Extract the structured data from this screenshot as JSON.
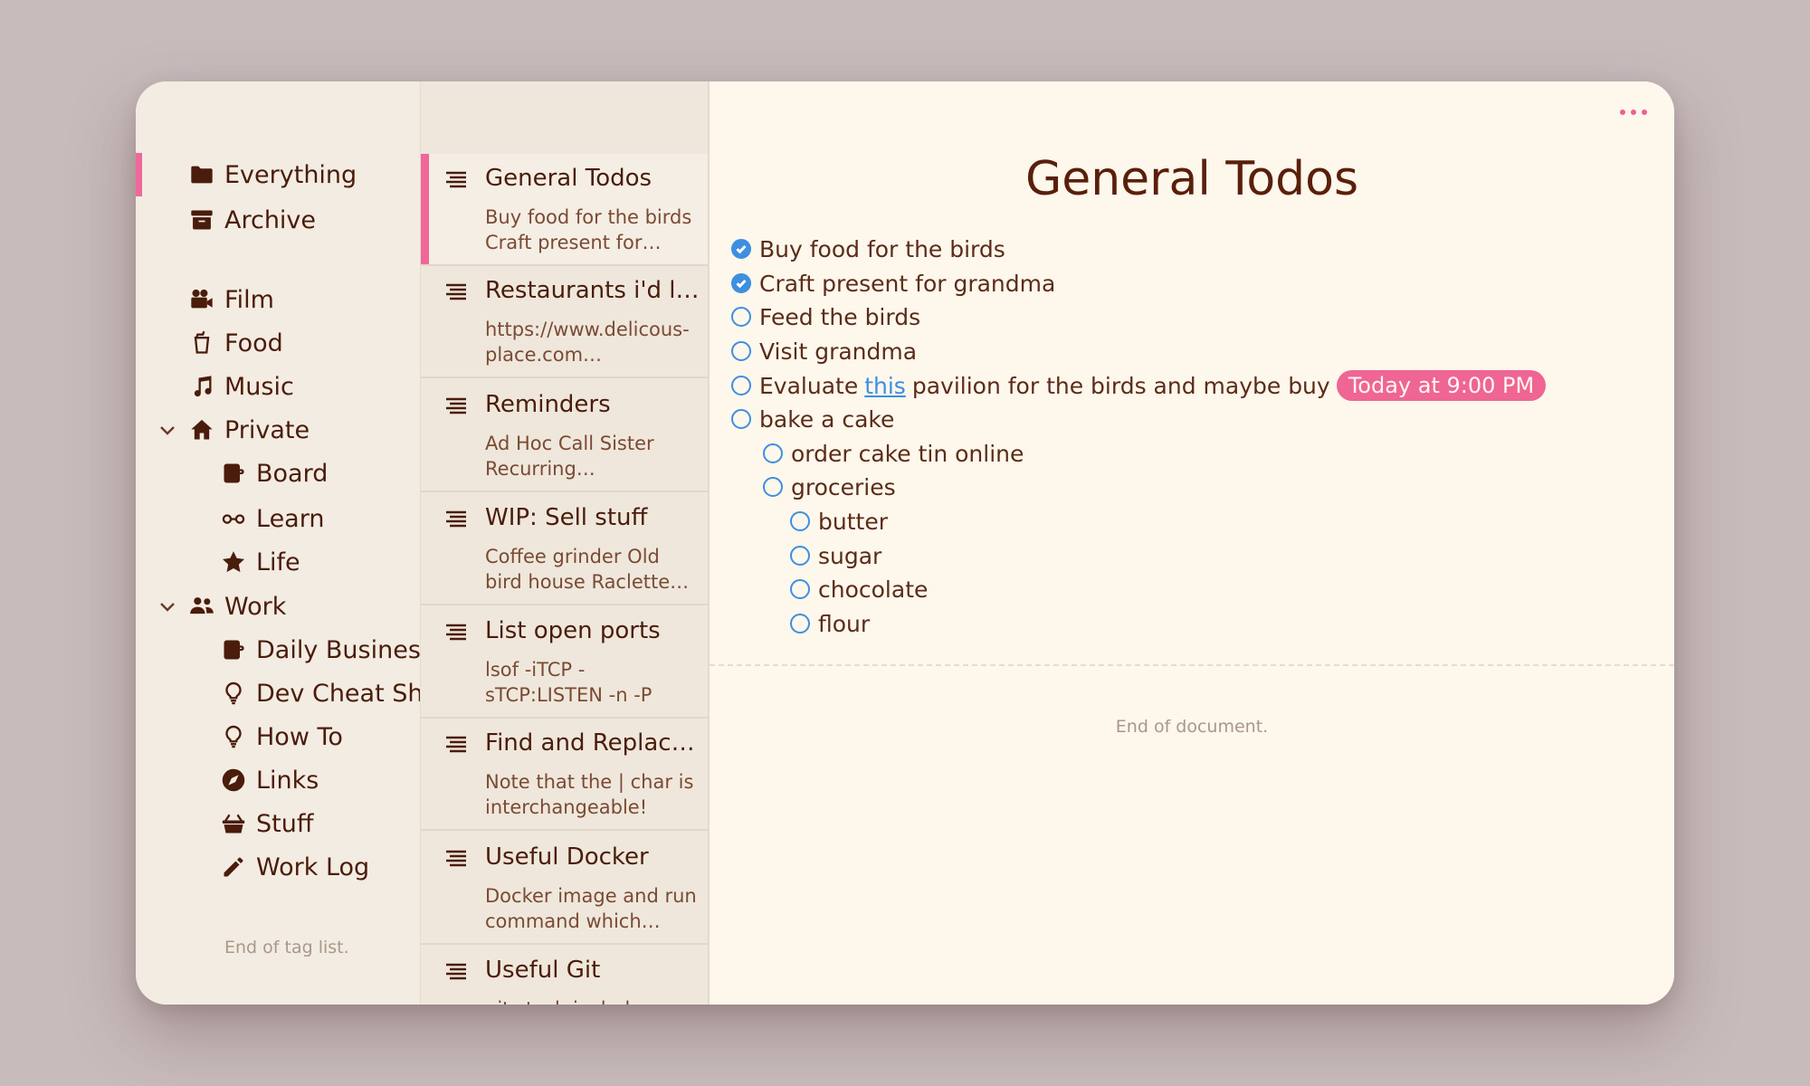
{
  "sidebar": {
    "tags": [
      {
        "label": "Everything",
        "icon": "folder-icon",
        "selected": true
      },
      {
        "label": "Archive",
        "icon": "archive-box-icon"
      },
      {
        "label": "Film",
        "icon": "movie-camera-icon"
      },
      {
        "label": "Food",
        "icon": "cup-icon"
      },
      {
        "label": "Music",
        "icon": "music-note-icon"
      },
      {
        "label": "Private",
        "icon": "house-icon",
        "expanded": true
      },
      {
        "label": "Board",
        "icon": "mug-icon"
      },
      {
        "label": "Learn",
        "icon": "glasses-icon"
      },
      {
        "label": "Life",
        "icon": "star-icon"
      },
      {
        "label": "Work",
        "icon": "people-icon",
        "expanded": true
      },
      {
        "label": "Daily Business",
        "icon": "mug-icon"
      },
      {
        "label": "Dev Cheat Sheets",
        "icon": "lightbulb-icon"
      },
      {
        "label": "How To",
        "icon": "lightbulb-icon"
      },
      {
        "label": "Links",
        "icon": "compass-icon"
      },
      {
        "label": "Stuff",
        "icon": "basket-icon"
      },
      {
        "label": "Work Log",
        "icon": "pencil-icon"
      }
    ],
    "end_text": "End of tag list."
  },
  "notes": [
    {
      "title": "General Todos",
      "preview": "Buy food for the birds Craft present for…",
      "selected": true
    },
    {
      "title": "Restaurants i'd like to try",
      "preview": "https://www.delicous-place.com…"
    },
    {
      "title": "Reminders",
      "preview": "Ad Hoc Call Sister Recurring…"
    },
    {
      "title": "WIP: Sell stuff",
      "preview": "Coffee grinder Old bird house Raclette…"
    },
    {
      "title": "List open ports",
      "preview": "lsof -iTCP -sTCP:LISTEN -n -P"
    },
    {
      "title": "Find and Replace in vim",
      "preview": "Note that the | char is interchangeable! E.g.…"
    },
    {
      "title": "Useful Docker",
      "preview": "Docker image and run command which…"
    },
    {
      "title": "Useful Git",
      "preview": "git stash include untracked"
    }
  ],
  "editor": {
    "title": "General Todos",
    "todos": [
      {
        "text": "Buy food for the birds",
        "checked": true,
        "level": 0
      },
      {
        "text": "Craft present for grandma",
        "checked": true,
        "level": 0
      },
      {
        "text": "Feed the birds",
        "checked": false,
        "level": 0
      },
      {
        "text": "Visit grandma",
        "checked": false,
        "level": 0
      },
      {
        "text_before": "Evaluate",
        "link": "this",
        "text_after": "pavilion for the birds and maybe buy",
        "reminder": "Today at 9:00 PM",
        "checked": false,
        "level": 0
      },
      {
        "text": "bake a cake",
        "checked": false,
        "level": 0
      },
      {
        "text": "order cake tin online",
        "checked": false,
        "level": 1
      },
      {
        "text": "groceries",
        "checked": false,
        "level": 1
      },
      {
        "text": "butter",
        "checked": false,
        "level": 2
      },
      {
        "text": "sugar",
        "checked": false,
        "level": 2
      },
      {
        "text": "chocolate",
        "checked": false,
        "level": 2
      },
      {
        "text": "flour",
        "checked": false,
        "level": 2
      }
    ],
    "end_text": "End of document."
  },
  "colors": {
    "accent": "#f0679a",
    "checkbox": "#3d8fe0",
    "text": "#4a1c0b",
    "background": "#c8bbbc"
  }
}
